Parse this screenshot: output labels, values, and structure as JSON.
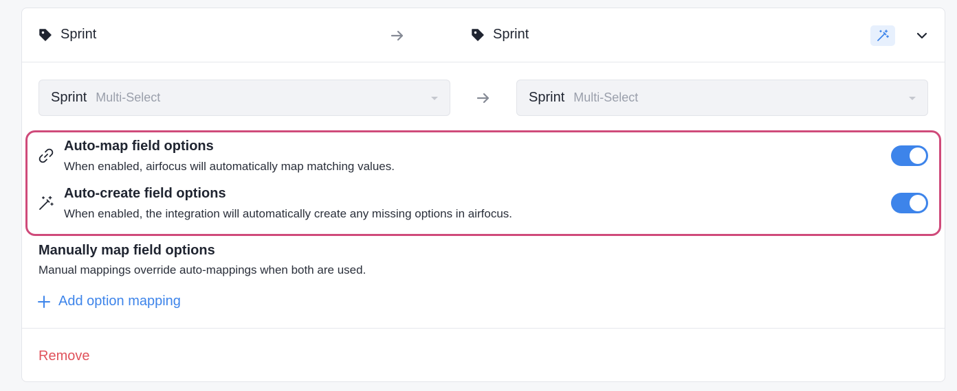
{
  "header": {
    "source_field": "Sprint",
    "target_field": "Sprint"
  },
  "mapping": {
    "source_select": {
      "name": "Sprint",
      "type": "Multi-Select"
    },
    "target_select": {
      "name": "Sprint",
      "type": "Multi-Select"
    }
  },
  "auto_options": [
    {
      "title": "Auto-map field options",
      "description": "When enabled, airfocus will automatically map matching values.",
      "enabled": true,
      "icon": "link-icon"
    },
    {
      "title": "Auto-create field options",
      "description": "When enabled, the integration will automatically create any missing options in airfocus.",
      "enabled": true,
      "icon": "magic-wand-icon"
    }
  ],
  "manual": {
    "title": "Manually map field options",
    "description": "Manual mappings override auto-mappings when both are used.",
    "add_label": "Add option mapping"
  },
  "footer": {
    "remove_label": "Remove"
  },
  "colors": {
    "accent": "#3d84ea",
    "highlight_border": "#cf4a7a",
    "danger": "#e0525b"
  }
}
